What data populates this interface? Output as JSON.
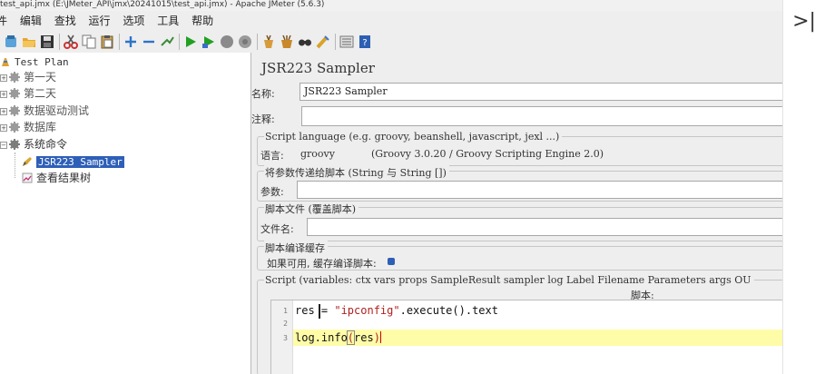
{
  "window": {
    "title": "test_api.jmx (E:\\JMeter_API\\jmx\\20241015\\test_api.jmx) - Apache JMeter (5.6.3)"
  },
  "menu": [
    "件",
    "编辑",
    "查找",
    "运行",
    "选项",
    "工具",
    "帮助"
  ],
  "toolbar": {
    "icons": [
      "templates-icon",
      "open-icon",
      "save-icon",
      "cut-icon",
      "copy-icon",
      "paste-icon",
      "expand-icon",
      "collapse-icon",
      "toggle-icon",
      "start-icon",
      "start-no-pause-icon",
      "stop-icon",
      "shutdown-icon",
      "clear-icon",
      "clear-all-icon",
      "search-icon",
      "reset-search-icon",
      "function-helper-icon",
      "help-icon"
    ]
  },
  "tree": {
    "items": [
      {
        "label": "Test Plan",
        "icon": "test-plan-icon"
      },
      {
        "label": "第一天",
        "icon": "gear-icon"
      },
      {
        "label": "第二天",
        "icon": "gear-icon"
      },
      {
        "label": "数据驱动测试",
        "icon": "gear-icon"
      },
      {
        "label": "数据库",
        "icon": "gear-icon"
      },
      {
        "label": "系统命令",
        "icon": "gear-icon"
      },
      {
        "label": "JSR223 Sampler",
        "icon": "pencil-icon",
        "selected": true
      },
      {
        "label": "查看结果树",
        "icon": "chart-icon"
      }
    ]
  },
  "panel": {
    "title": "JSR223 Sampler",
    "name_label": "名称:",
    "name_value": "JSR223 Sampler",
    "comment_label": "注释:",
    "comment_value": "",
    "language_group": "Script language (e.g. groovy, beanshell, javascript, jexl ...)",
    "language_label": "语言:",
    "language_value": "groovy",
    "language_engine": "(Groovy 3.0.20 / Groovy Scripting Engine 2.0)",
    "params_group": "将参数传递给脚本 (String 与 String [])",
    "params_label": "参数:",
    "params_value": "",
    "file_group": "脚本文件 (覆盖脚本)",
    "file_label": "文件名:",
    "file_value": "",
    "cache_group": "脚本编译缓存",
    "cache_label": "如果可用, 缓存编译脚本:",
    "cache_checked": true,
    "script_group": "Script (variables: ctx vars props SampleResult sampler log Label Filename Parameters args OU",
    "script_sub": "脚本:",
    "code_lines": [
      "1",
      "2",
      "3"
    ],
    "code": {
      "line1_a": "res ",
      "line1_b": "= ",
      "line1_str": "\"ipconfig\"",
      "line1_c": ".execute().text",
      "line3_a": "log.info",
      "line3_p1": "(",
      "line3_b": "res",
      "line3_p2": ")"
    }
  },
  "sidebar_toggle": ">|"
}
